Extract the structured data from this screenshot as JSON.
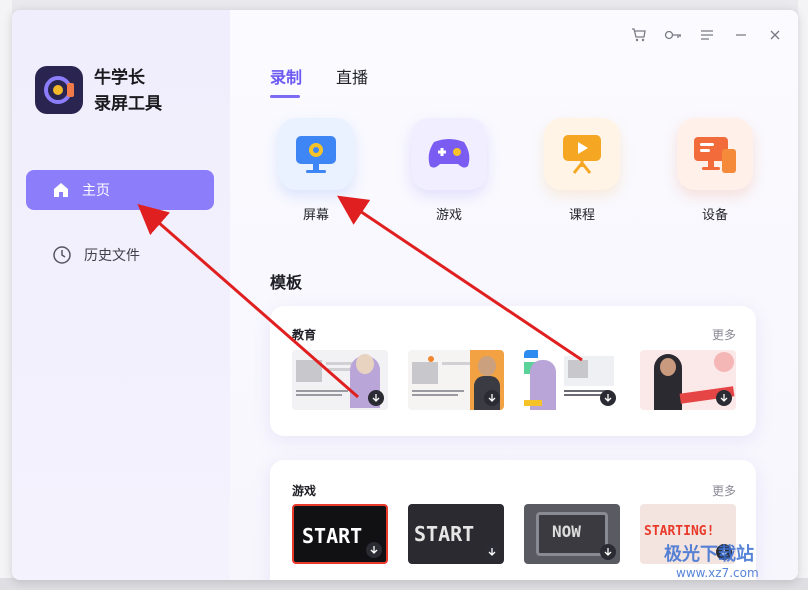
{
  "app": {
    "name_line1": "牛学长",
    "name_line2": "录屏工具"
  },
  "sidebar": {
    "items": [
      {
        "label": "主页",
        "icon": "home-icon",
        "active": true
      },
      {
        "label": "历史文件",
        "icon": "clock-icon",
        "active": false
      }
    ]
  },
  "tabs": [
    {
      "label": "录制",
      "active": true
    },
    {
      "label": "直播",
      "active": false
    }
  ],
  "modes": [
    {
      "label": "屏幕",
      "icon": "monitor-icon"
    },
    {
      "label": "游戏",
      "icon": "gamepad-icon"
    },
    {
      "label": "课程",
      "icon": "course-icon"
    },
    {
      "label": "设备",
      "icon": "device-icon"
    }
  ],
  "templates": {
    "title": "模板",
    "groups": [
      {
        "title": "教育",
        "more": "更多"
      },
      {
        "title": "游戏",
        "more": "更多"
      }
    ],
    "game_thumb_text": [
      "START",
      "START",
      "NOW",
      "STARTING!"
    ]
  },
  "watermark": {
    "line1": "极光下载站",
    "line2": "www.xz7.com"
  },
  "colors": {
    "accent": "#8c7dfa",
    "annotation": "#e02020"
  }
}
